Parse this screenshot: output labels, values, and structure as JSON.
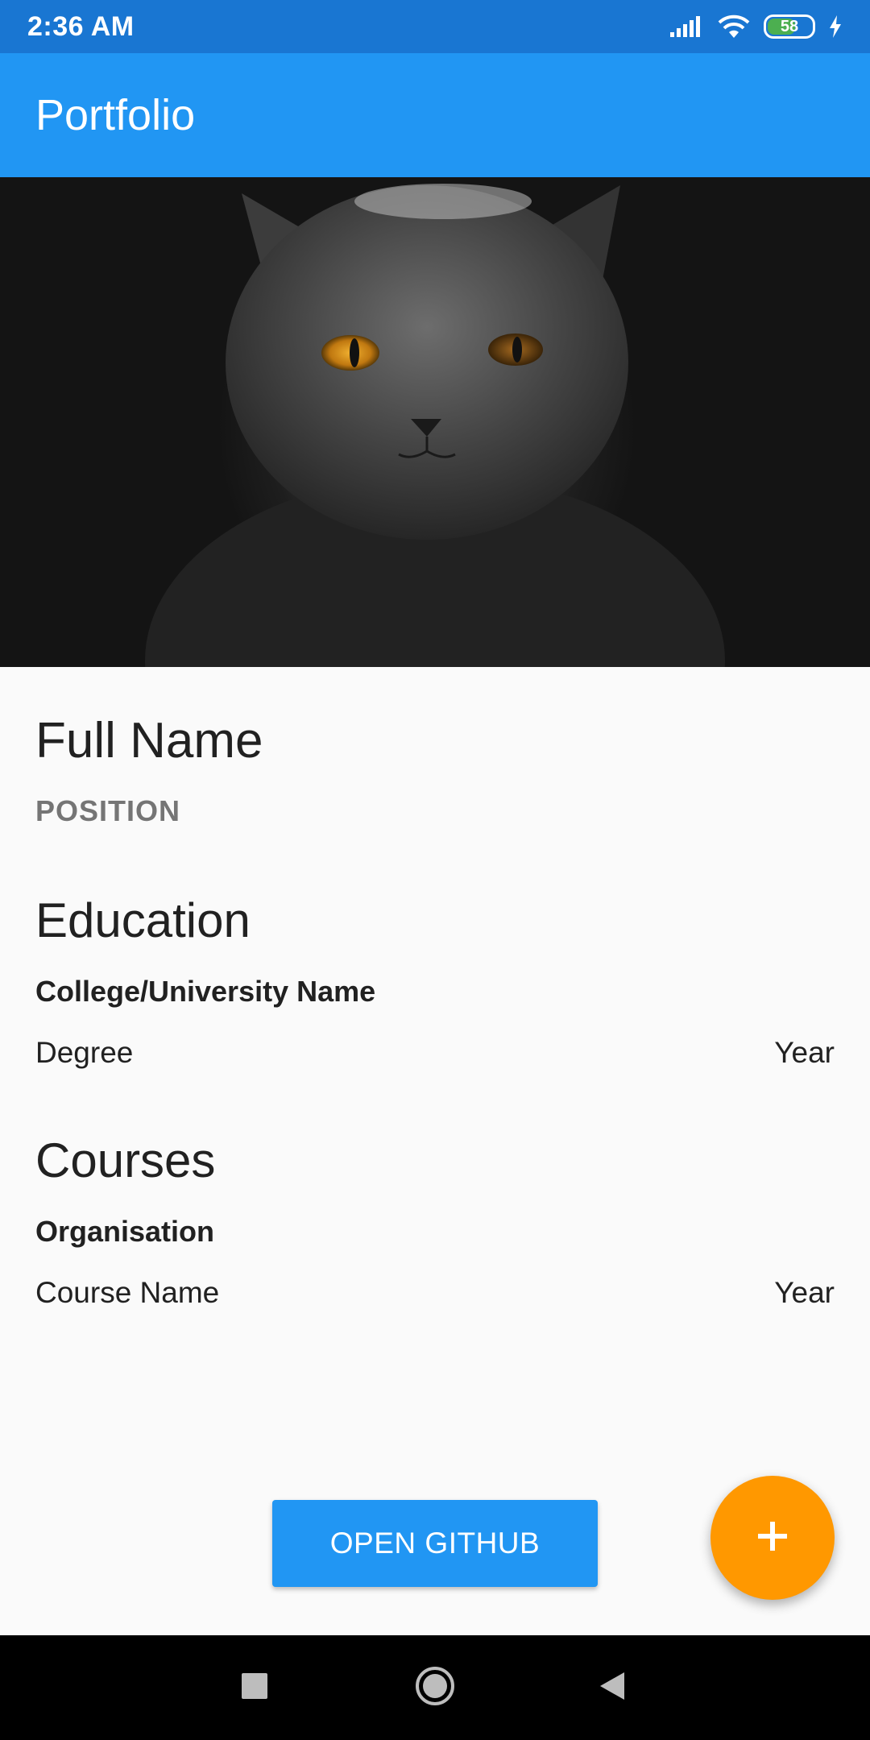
{
  "status_bar": {
    "time": "2:36 AM",
    "battery_level": "58",
    "icons": [
      "signal-icon",
      "wifi-icon",
      "battery-icon",
      "charging-icon"
    ]
  },
  "app_bar": {
    "title": "Portfolio"
  },
  "hero": {
    "icon": "cat-photo"
  },
  "profile": {
    "full_name": "Full Name",
    "position": "POSITION"
  },
  "education": {
    "title": "Education",
    "institution": "College/University Name",
    "degree": "Degree",
    "year": "Year"
  },
  "courses": {
    "title": "Courses",
    "organisation": "Organisation",
    "course_name": "Course Name",
    "year": "Year"
  },
  "actions": {
    "github_label": "OPEN GITHUB",
    "fab_icon": "plus-icon"
  },
  "nav_bar": {
    "icons": [
      "recents-icon",
      "home-icon",
      "back-icon"
    ]
  },
  "colors": {
    "status_bar": "#1976d2",
    "primary": "#2196f3",
    "accent": "#ff9800",
    "background": "#fafafa"
  }
}
